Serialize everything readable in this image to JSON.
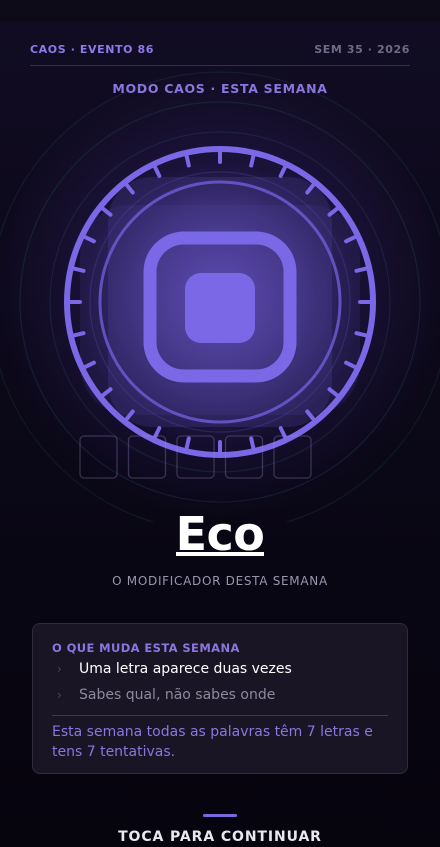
{
  "header": {
    "event_label": "CAOS · EVENTO 86",
    "week_label": "SEM 35 · 2026"
  },
  "mode_label": "MODO CAOS · ESTA SEMANA",
  "hero": {
    "icon": "echo-square-icon",
    "accent_color": "#7a68e6",
    "slots_count": 5
  },
  "modifier": {
    "title": "Eco",
    "subtitle": "O MODIFICADOR DESTA SEMANA"
  },
  "card": {
    "title": "O QUE MUDA ESTA SEMANA",
    "rules": [
      {
        "icon": "chevron-right-icon",
        "text": "Uma letra aparece duas vezes"
      },
      {
        "icon": "chevron-right-icon",
        "text": "Sabes qual, não sabes onde"
      }
    ],
    "description": "Esta semana todas as palavras têm 7 letras e tens 7 tentativas."
  },
  "continue_label": "TOCA PARA CONTINUAR",
  "colors": {
    "accent": "#8b76e0",
    "background": "#07050f",
    "card": "#1c1828"
  }
}
